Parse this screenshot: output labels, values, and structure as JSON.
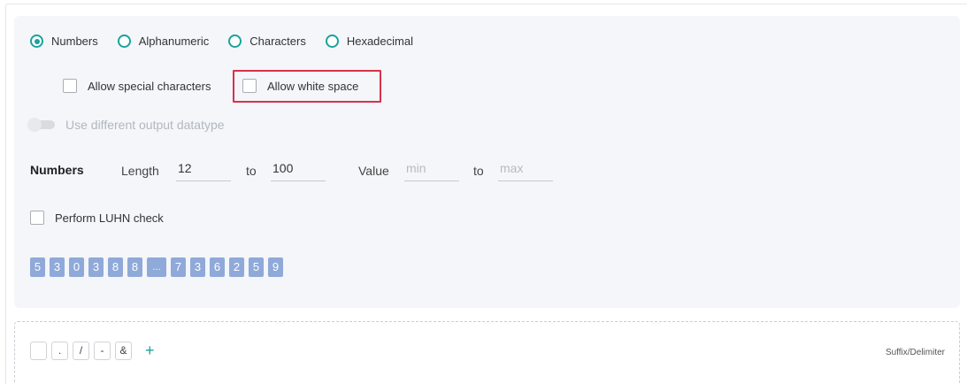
{
  "format_options": [
    {
      "label": "Numbers",
      "selected": true
    },
    {
      "label": "Alphanumeric",
      "selected": false
    },
    {
      "label": "Characters",
      "selected": false
    },
    {
      "label": "Hexadecimal",
      "selected": false
    }
  ],
  "checkboxes": {
    "allow_special": "Allow special characters",
    "allow_whitespace": "Allow white space"
  },
  "toggle": {
    "label": "Use different output datatype",
    "enabled": false
  },
  "numbers_row": {
    "heading": "Numbers",
    "length_label": "Length",
    "length_min": "12",
    "to_label": "to",
    "length_max": "100",
    "value_label": "Value",
    "value_min_placeholder": "min",
    "value_max_placeholder": "max"
  },
  "luhn": {
    "label": "Perform LUHN check"
  },
  "sample_digits": [
    "5",
    "3",
    "0",
    "3",
    "8",
    "8",
    "...",
    "7",
    "3",
    "6",
    "2",
    "5",
    "9"
  ],
  "suffix": {
    "buttons": [
      "",
      ".",
      "/",
      "-",
      "&"
    ],
    "add_label": "+",
    "label": "Suffix/Delimiter"
  },
  "colors": {
    "accent": "#1aa39b",
    "highlight": "#d9314b",
    "tile": "#8fa9d9"
  }
}
